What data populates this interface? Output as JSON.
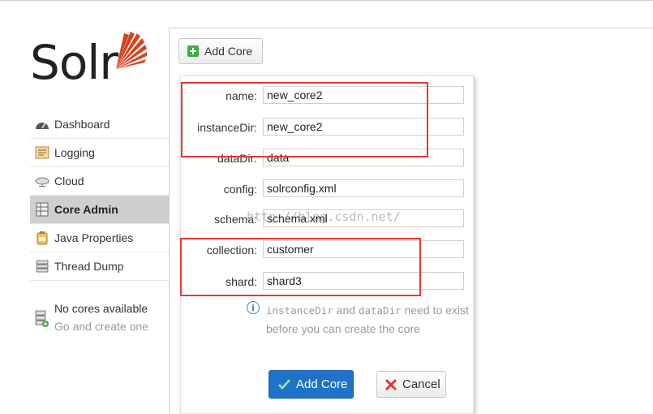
{
  "logo": {
    "text": "Solr",
    "accent_color": "#d9411e"
  },
  "sidebar": {
    "items": [
      {
        "label": "Dashboard",
        "icon": "dashboard-icon",
        "active": false
      },
      {
        "label": "Logging",
        "icon": "logging-icon",
        "active": false
      },
      {
        "label": "Cloud",
        "icon": "cloud-icon",
        "active": false
      },
      {
        "label": "Core Admin",
        "icon": "core-admin-icon",
        "active": true
      },
      {
        "label": "Java Properties",
        "icon": "java-properties-icon",
        "active": false
      },
      {
        "label": "Thread Dump",
        "icon": "thread-dump-icon",
        "active": false
      }
    ],
    "no_cores": {
      "title": "No cores available",
      "subtitle": "Go and create one"
    }
  },
  "toolbar": {
    "add_core_label": "Add Core"
  },
  "form": {
    "fields": [
      {
        "label": "name:",
        "value": "new_core2"
      },
      {
        "label": "instanceDir:",
        "value": "new_core2"
      },
      {
        "label": "dataDir:",
        "value": "data"
      },
      {
        "label": "config:",
        "value": "solrconfig.xml"
      },
      {
        "label": "schema:",
        "value": "schema.xml"
      },
      {
        "label": "collection:",
        "value": "customer"
      },
      {
        "label": "shard:",
        "value": "shard3"
      }
    ],
    "info": {
      "code1": "instanceDir",
      "and": " and ",
      "code2": "dataDir",
      "rest": " need to exist before you can create the core"
    },
    "submit_label": "Add Core",
    "cancel_label": "Cancel"
  },
  "watermark": "http://blog.csdn.net/",
  "colors": {
    "primary_button": "#1e73c9",
    "highlight_box": "#e53935",
    "active_nav": "#cfcfcf"
  }
}
